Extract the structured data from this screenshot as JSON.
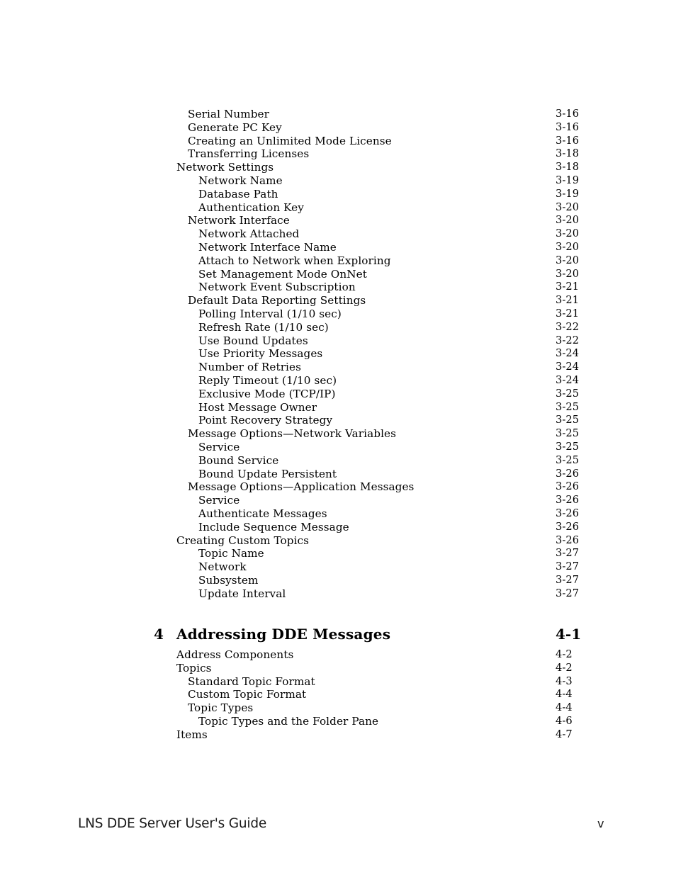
{
  "document": {
    "footer_title": "LNS DDE Server User's Guide",
    "folio": "v"
  },
  "toc": {
    "continued_entries": [
      {
        "label": "Serial Number",
        "page": "3-16",
        "level": 2
      },
      {
        "label": "Generate PC Key",
        "page": "3-16",
        "level": 2
      },
      {
        "label": "Creating an Unlimited Mode License",
        "page": "3-16",
        "level": 2
      },
      {
        "label": "Transferring Licenses",
        "page": "3-18",
        "level": 2
      },
      {
        "label": "Network Settings",
        "page": "3-18",
        "level": 1
      },
      {
        "label": "Network Name",
        "page": "3-19",
        "level": 3
      },
      {
        "label": "Database Path",
        "page": "3-19",
        "level": 3
      },
      {
        "label": "Authentication Key",
        "page": "3-20",
        "level": 3
      },
      {
        "label": "Network Interface",
        "page": "3-20",
        "level": 2
      },
      {
        "label": "Network Attached",
        "page": "3-20",
        "level": 3
      },
      {
        "label": "Network Interface Name",
        "page": "3-20",
        "level": 3
      },
      {
        "label": "Attach to Network when Exploring",
        "page": "3-20",
        "level": 3
      },
      {
        "label": "Set Management Mode OnNet",
        "page": "3-20",
        "level": 3
      },
      {
        "label": "Network Event Subscription",
        "page": "3-21",
        "level": 3
      },
      {
        "label": "Default Data Reporting Settings",
        "page": "3-21",
        "level": 2
      },
      {
        "label": "Polling Interval (1/10 sec)",
        "page": "3-21",
        "level": 3
      },
      {
        "label": "Refresh Rate (1/10 sec)",
        "page": "3-22",
        "level": 3
      },
      {
        "label": "Use Bound Updates",
        "page": "3-22",
        "level": 3
      },
      {
        "label": "Use Priority Messages",
        "page": "3-24",
        "level": 3
      },
      {
        "label": "Number of Retries",
        "page": "3-24",
        "level": 3
      },
      {
        "label": "Reply Timeout (1/10 sec)",
        "page": "3-24",
        "level": 3
      },
      {
        "label": "Exclusive Mode (TCP/IP)",
        "page": "3-25",
        "level": 3
      },
      {
        "label": "Host Message Owner",
        "page": "3-25",
        "level": 3
      },
      {
        "label": "Point Recovery Strategy",
        "page": "3-25",
        "level": 3
      },
      {
        "label": "Message Options—Network Variables",
        "page": "3-25",
        "level": 2
      },
      {
        "label": "Service",
        "page": "3-25",
        "level": 3
      },
      {
        "label": "Bound Service",
        "page": "3-25",
        "level": 3
      },
      {
        "label": "Bound Update Persistent",
        "page": "3-26",
        "level": 3
      },
      {
        "label": "Message Options—Application Messages",
        "page": "3-26",
        "level": 2
      },
      {
        "label": "Service",
        "page": "3-26",
        "level": 3
      },
      {
        "label": "Authenticate Messages",
        "page": "3-26",
        "level": 3
      },
      {
        "label": "Include Sequence Message",
        "page": "3-26",
        "level": 3
      },
      {
        "label": "Creating Custom Topics",
        "page": "3-26",
        "level": 1
      },
      {
        "label": "Topic Name",
        "page": "3-27",
        "level": 3
      },
      {
        "label": "Network",
        "page": "3-27",
        "level": 3
      },
      {
        "label": "Subsystem",
        "page": "3-27",
        "level": 3
      },
      {
        "label": "Update Interval",
        "page": "3-27",
        "level": 3
      }
    ],
    "chapter": {
      "number": "4",
      "title": "Addressing DDE Messages",
      "page": "4-1",
      "entries": [
        {
          "label": "Address Components",
          "page": "4-2",
          "level": 1
        },
        {
          "label": "Topics",
          "page": "4-2",
          "level": 1
        },
        {
          "label": "Standard Topic Format",
          "page": "4-3",
          "level": 2
        },
        {
          "label": "Custom Topic Format",
          "page": "4-4",
          "level": 2
        },
        {
          "label": "Topic Types",
          "page": "4-4",
          "level": 2
        },
        {
          "label": "Topic Types and the Folder Pane",
          "page": "4-6",
          "level": 3
        },
        {
          "label": "Items",
          "page": "4-7",
          "level": 1
        }
      ]
    }
  }
}
